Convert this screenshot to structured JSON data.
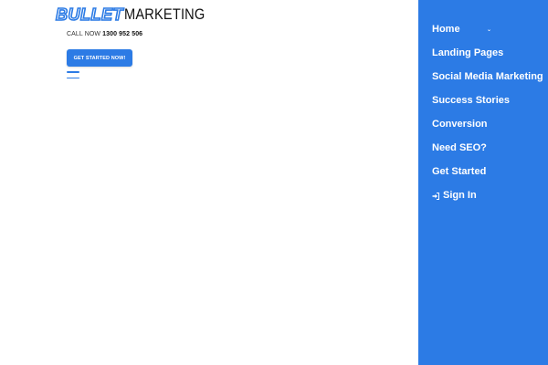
{
  "brand": {
    "logo_part1": "BULLET",
    "logo_part2": "MARKETING",
    "accent_color": "#2c7be5"
  },
  "header": {
    "call_label": "CALL NOW",
    "call_number": "1300 952 506",
    "cta_label": "GET STARTED NOW!",
    "menu_icon": "hamburger-icon"
  },
  "side_menu": {
    "background_color": "#2c7be5",
    "items": [
      {
        "label": "Home",
        "icon": "chevron-down-icon"
      },
      {
        "label": "Landing Pages"
      },
      {
        "label": "Social Media Marketing"
      },
      {
        "label": "Success Stories"
      },
      {
        "label": "Conversion"
      },
      {
        "label": "Need SEO?"
      },
      {
        "label": "Get Started"
      },
      {
        "label": "Sign In",
        "icon": "sign-in-icon"
      }
    ]
  }
}
